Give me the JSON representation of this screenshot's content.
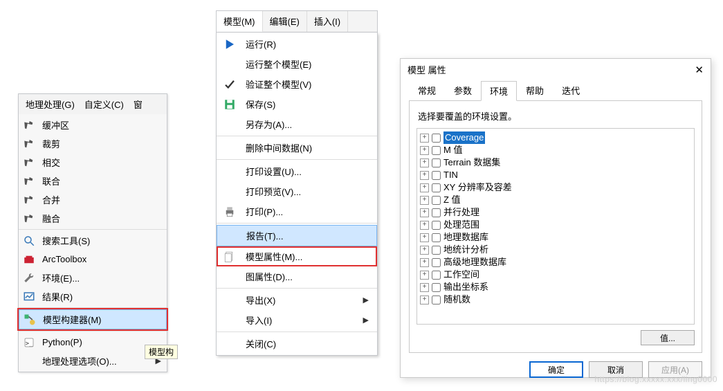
{
  "panel1": {
    "menubar": [
      "地理处理(G)",
      "自定义(C)",
      "窗"
    ],
    "items": [
      {
        "icon": "hammer",
        "label": "缓冲区"
      },
      {
        "icon": "hammer",
        "label": "裁剪"
      },
      {
        "icon": "hammer",
        "label": "相交"
      },
      {
        "icon": "hammer",
        "label": "联合"
      },
      {
        "icon": "hammer",
        "label": "合并"
      },
      {
        "icon": "hammer",
        "label": "融合"
      }
    ],
    "items2": [
      {
        "icon": "search",
        "label": "搜索工具(S)"
      },
      {
        "icon": "toolbox",
        "label": "ArcToolbox"
      },
      {
        "icon": "env",
        "label": "环境(E)..."
      },
      {
        "icon": "results",
        "label": "结果(R)"
      }
    ],
    "builder": {
      "icon": "model",
      "label": "模型构建器(M)"
    },
    "items3": [
      {
        "icon": "python",
        "label": "Python(P)"
      },
      {
        "icon": "opts",
        "label": "地理处理选项(O)...",
        "arrow": true
      }
    ],
    "tooltip": "模型构"
  },
  "panel2": {
    "menubar": [
      "模型(M)",
      "编辑(E)",
      "插入(I)"
    ],
    "items": [
      {
        "icon": "play",
        "label": "运行(R)"
      },
      {
        "icon": "",
        "label": "运行整个模型(E)"
      },
      {
        "icon": "check",
        "label": "验证整个模型(V)"
      },
      {
        "icon": "save",
        "label": "保存(S)"
      },
      {
        "icon": "",
        "label": "另存为(A)..."
      },
      {
        "sep": true
      },
      {
        "icon": "",
        "label": "删除中间数据(N)"
      },
      {
        "sep": true
      },
      {
        "icon": "",
        "label": "打印设置(U)..."
      },
      {
        "icon": "",
        "label": "打印预览(V)..."
      },
      {
        "icon": "print",
        "label": "打印(P)..."
      },
      {
        "sep": true
      },
      {
        "icon": "",
        "label": "报告(T)...",
        "hl": "blue"
      },
      {
        "icon": "props",
        "label": "模型属性(M)...",
        "hl": "red"
      },
      {
        "icon": "",
        "label": "图属性(D)..."
      },
      {
        "sep": true
      },
      {
        "icon": "",
        "label": "导出(X)",
        "arrow": true
      },
      {
        "icon": "",
        "label": "导入(I)",
        "arrow": true
      },
      {
        "sep": true
      },
      {
        "icon": "",
        "label": "关闭(C)"
      }
    ]
  },
  "panel3": {
    "title": "模型 属性",
    "tabs": [
      "常规",
      "参数",
      "环境",
      "帮助",
      "迭代"
    ],
    "active_tab": 2,
    "desc": "选择要覆盖的环境设置。",
    "tree": [
      {
        "label": "Coverage",
        "selected": true
      },
      {
        "label": "M 值"
      },
      {
        "label": "Terrain 数据集"
      },
      {
        "label": "TIN"
      },
      {
        "label": "XY 分辨率及容差"
      },
      {
        "label": "Z 值"
      },
      {
        "label": "并行处理"
      },
      {
        "label": "处理范围"
      },
      {
        "label": "地理数据库"
      },
      {
        "label": "地统计分析"
      },
      {
        "label": "高级地理数据库"
      },
      {
        "label": "工作空间"
      },
      {
        "label": "输出坐标系"
      },
      {
        "label": "随机数"
      }
    ],
    "value_btn": "值...",
    "buttons": {
      "ok": "确定",
      "cancel": "取消",
      "apply": "应用(A)"
    }
  },
  "watermark": "https://blog.xxxxx.xxx/ling0000"
}
